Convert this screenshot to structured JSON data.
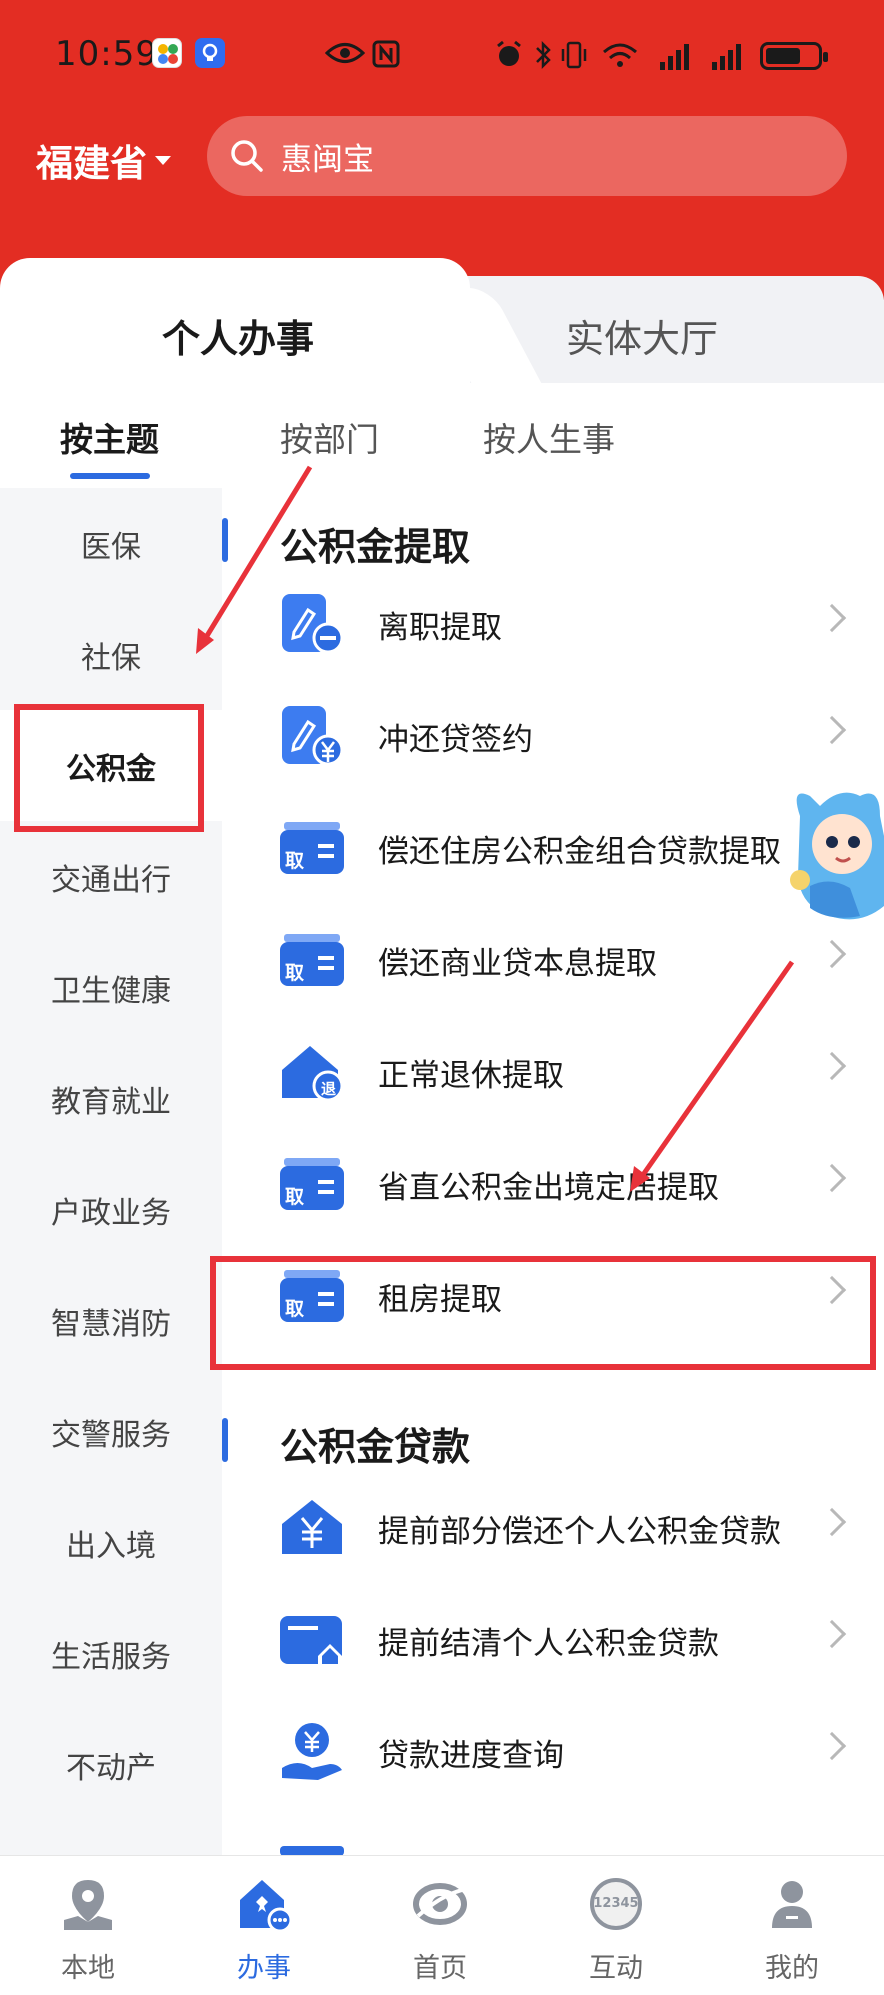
{
  "status_bar": {
    "time": "10:59"
  },
  "header": {
    "province": "福建省",
    "search_placeholder": "惠闽宝"
  },
  "segments": {
    "personal": "个人办事",
    "hall": "实体大厅"
  },
  "subtabs": [
    "按主题",
    "按部门",
    "按人生事"
  ],
  "sidebar": {
    "items": [
      "医保",
      "社保",
      "公积金",
      "交通出行",
      "卫生健康",
      "教育就业",
      "户政业务",
      "智慧消防",
      "交警服务",
      "出入境",
      "生活服务",
      "不动产"
    ],
    "active": "公积金"
  },
  "sections": [
    {
      "title": "公积金提取",
      "items": [
        {
          "label": "离职提取",
          "icon": "pen-minus-icon"
        },
        {
          "label": "冲还贷签约",
          "icon": "pen-yen-icon"
        },
        {
          "label": "偿还住房公积金组合贷款提取",
          "icon": "withdraw-card-icon"
        },
        {
          "label": "偿还商业贷本息提取",
          "icon": "withdraw-card-icon"
        },
        {
          "label": "正常退休提取",
          "icon": "house-retire-icon"
        },
        {
          "label": "省直公积金出境定居提取",
          "icon": "withdraw-card-icon"
        },
        {
          "label": "租房提取",
          "icon": "withdraw-card-icon"
        }
      ]
    },
    {
      "title": "公积金贷款",
      "items": [
        {
          "label": "提前部分偿还个人公积金贷款",
          "icon": "house-yen-icon"
        },
        {
          "label": "提前结清个人公积金贷款",
          "icon": "card-house-icon"
        },
        {
          "label": "贷款进度查询",
          "icon": "hand-yen-icon"
        }
      ]
    }
  ],
  "icon_text": {
    "withdraw": "取",
    "retire": "退"
  },
  "bottom_nav": [
    {
      "label": "本地",
      "icon": "location-icon"
    },
    {
      "label": "办事",
      "icon": "service-icon"
    },
    {
      "label": "首页",
      "icon": "home-logo-icon"
    },
    {
      "label": "互动",
      "icon": "hotline-icon"
    },
    {
      "label": "我的",
      "icon": "user-icon"
    }
  ],
  "bottom_nav_active": "办事",
  "hotline_number": "12345",
  "colors": {
    "header_red": "#e32d23",
    "accent_blue": "#2c6be0",
    "highlight_red": "#e8323a"
  }
}
